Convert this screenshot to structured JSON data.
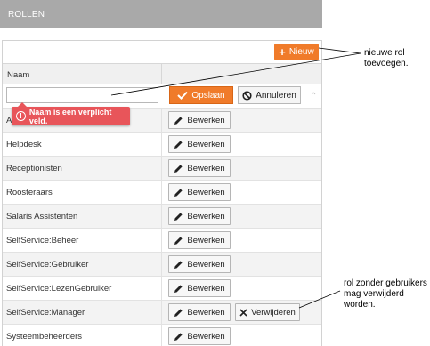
{
  "header": {
    "title": "ROLLEN"
  },
  "toolbar": {
    "new_label": "Nieuw"
  },
  "table": {
    "column_name": "Naam"
  },
  "edit": {
    "input_value": "",
    "save_label": "Opslaan",
    "cancel_label": "Annuleren",
    "error_message": "Naam is een verplicht veld."
  },
  "rows": [
    {
      "name": "A",
      "edit_label": "Bewerken"
    },
    {
      "name": "Helpdesk",
      "edit_label": "Bewerken"
    },
    {
      "name": "Receptionisten",
      "edit_label": "Bewerken"
    },
    {
      "name": "Roosteraars",
      "edit_label": "Bewerken"
    },
    {
      "name": "Salaris Assistenten",
      "edit_label": "Bewerken"
    },
    {
      "name": "SelfService:Beheer",
      "edit_label": "Bewerken"
    },
    {
      "name": "SelfService:Gebruiker",
      "edit_label": "Bewerken"
    },
    {
      "name": "SelfService:LezenGebruiker",
      "edit_label": "Bewerken"
    },
    {
      "name": "SelfService:Manager",
      "edit_label": "Bewerken",
      "delete_label": "Verwijderen"
    },
    {
      "name": "Systeembeheerders",
      "edit_label": "Bewerken"
    }
  ],
  "annotations": {
    "new_role_line1": "nieuwe rol",
    "new_role_line2": "toevoegen.",
    "unused_role_line1": "rol zonder gebruikers",
    "unused_role_line2": "mag verwijderd worden."
  },
  "colors": {
    "header_bg": "#a9a9a9",
    "accent": "#f07b2a",
    "error": "#e8555a"
  }
}
